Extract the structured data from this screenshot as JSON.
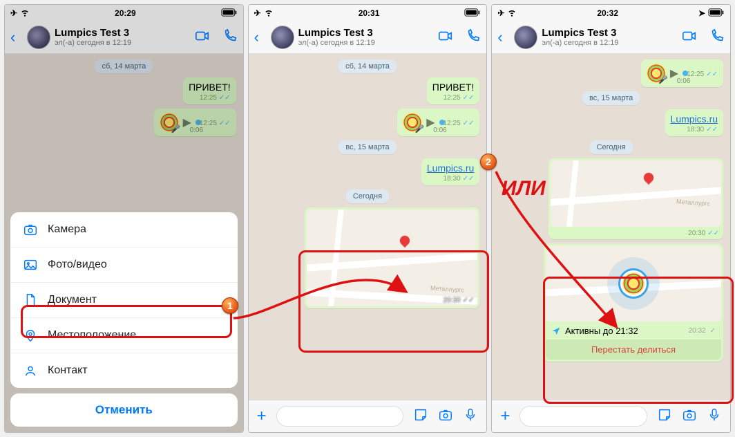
{
  "screens": [
    {
      "time": "20:29"
    },
    {
      "time": "20:31"
    },
    {
      "time": "20:32"
    }
  ],
  "contact": {
    "name": "Lumpics Test 3",
    "status": "эл(-а) сегодня в 12:19"
  },
  "messages": {
    "date1": "сб, 14 марта",
    "greeting": "ПРИВЕТ!",
    "greeting_time": "12:25",
    "voice_duration": "0:06",
    "voice_time": "12:25",
    "date2": "вс, 15 марта",
    "link_text": "Lumpics.ru",
    "link_time": "18:30",
    "today": "Сегодня",
    "map_street": "Металлургс",
    "map_time": "20:30",
    "live_until": "Активны до 21:32",
    "live_time": "20:32",
    "stop_sharing": "Перестать делиться"
  },
  "attach_sheet": {
    "camera": "Камера",
    "photo_video": "Фото/видео",
    "document": "Документ",
    "location": "Местоположение",
    "contact": "Контакт",
    "cancel": "Отменить"
  },
  "annotations": {
    "or": "ИЛИ",
    "badge1": "1",
    "badge2": "2"
  }
}
